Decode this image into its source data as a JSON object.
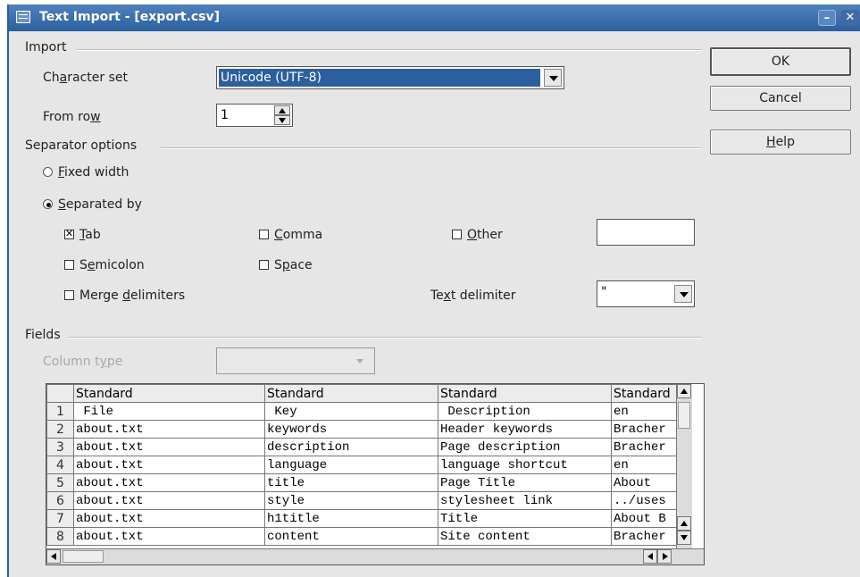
{
  "window": {
    "title": "Text Import - [export.csv]"
  },
  "import": {
    "group_label": "Import",
    "charset_label": "Character set",
    "charset_value": "Unicode (UTF-8)",
    "from_row_label": "From row",
    "from_row_value": "1"
  },
  "separator": {
    "group_label": "Separator options",
    "fixed_width": "Fixed width",
    "separated_by": "Separated by",
    "selected": "separated_by",
    "tab": "Tab",
    "comma": "Comma",
    "other": "Other",
    "semicolon": "Semicolon",
    "space": "Space",
    "merge": "Merge delimiters",
    "text_delimiter_label": "Text delimiter",
    "text_delimiter_value": "\"",
    "other_value": "",
    "checked": {
      "tab": true,
      "comma": false,
      "other": false,
      "semicolon": false,
      "space": false,
      "merge": false
    }
  },
  "buttons": {
    "ok": "OK",
    "cancel": "Cancel",
    "help": "Help"
  },
  "fields": {
    "group_label": "Fields",
    "column_type_label": "Column type",
    "column_type_value": "",
    "headers": [
      "Standard",
      "Standard",
      "Standard",
      "Standard"
    ],
    "rows": [
      {
        "num": "1",
        "cells": [
          " File",
          " Key",
          " Description",
          "en"
        ]
      },
      {
        "num": "2",
        "cells": [
          "about.txt",
          "keywords",
          "Header keywords",
          "Bracher"
        ]
      },
      {
        "num": "3",
        "cells": [
          "about.txt",
          "description",
          "Page description",
          "Bracher"
        ]
      },
      {
        "num": "4",
        "cells": [
          "about.txt",
          "language",
          "language shortcut",
          "en"
        ]
      },
      {
        "num": "5",
        "cells": [
          "about.txt",
          "title",
          "Page Title",
          "About"
        ]
      },
      {
        "num": "6",
        "cells": [
          "about.txt",
          "style",
          "stylesheet link",
          "../uses"
        ]
      },
      {
        "num": "7",
        "cells": [
          "about.txt",
          "h1title",
          "Title",
          "About B"
        ]
      },
      {
        "num": "8",
        "cells": [
          "about.txt",
          "content",
          "Site content",
          "Bracher"
        ]
      }
    ]
  },
  "colors": {
    "titlebar": "#2c5f9e",
    "selection": "#2c5f9e",
    "dialog_bg": "#e6e6e6"
  }
}
